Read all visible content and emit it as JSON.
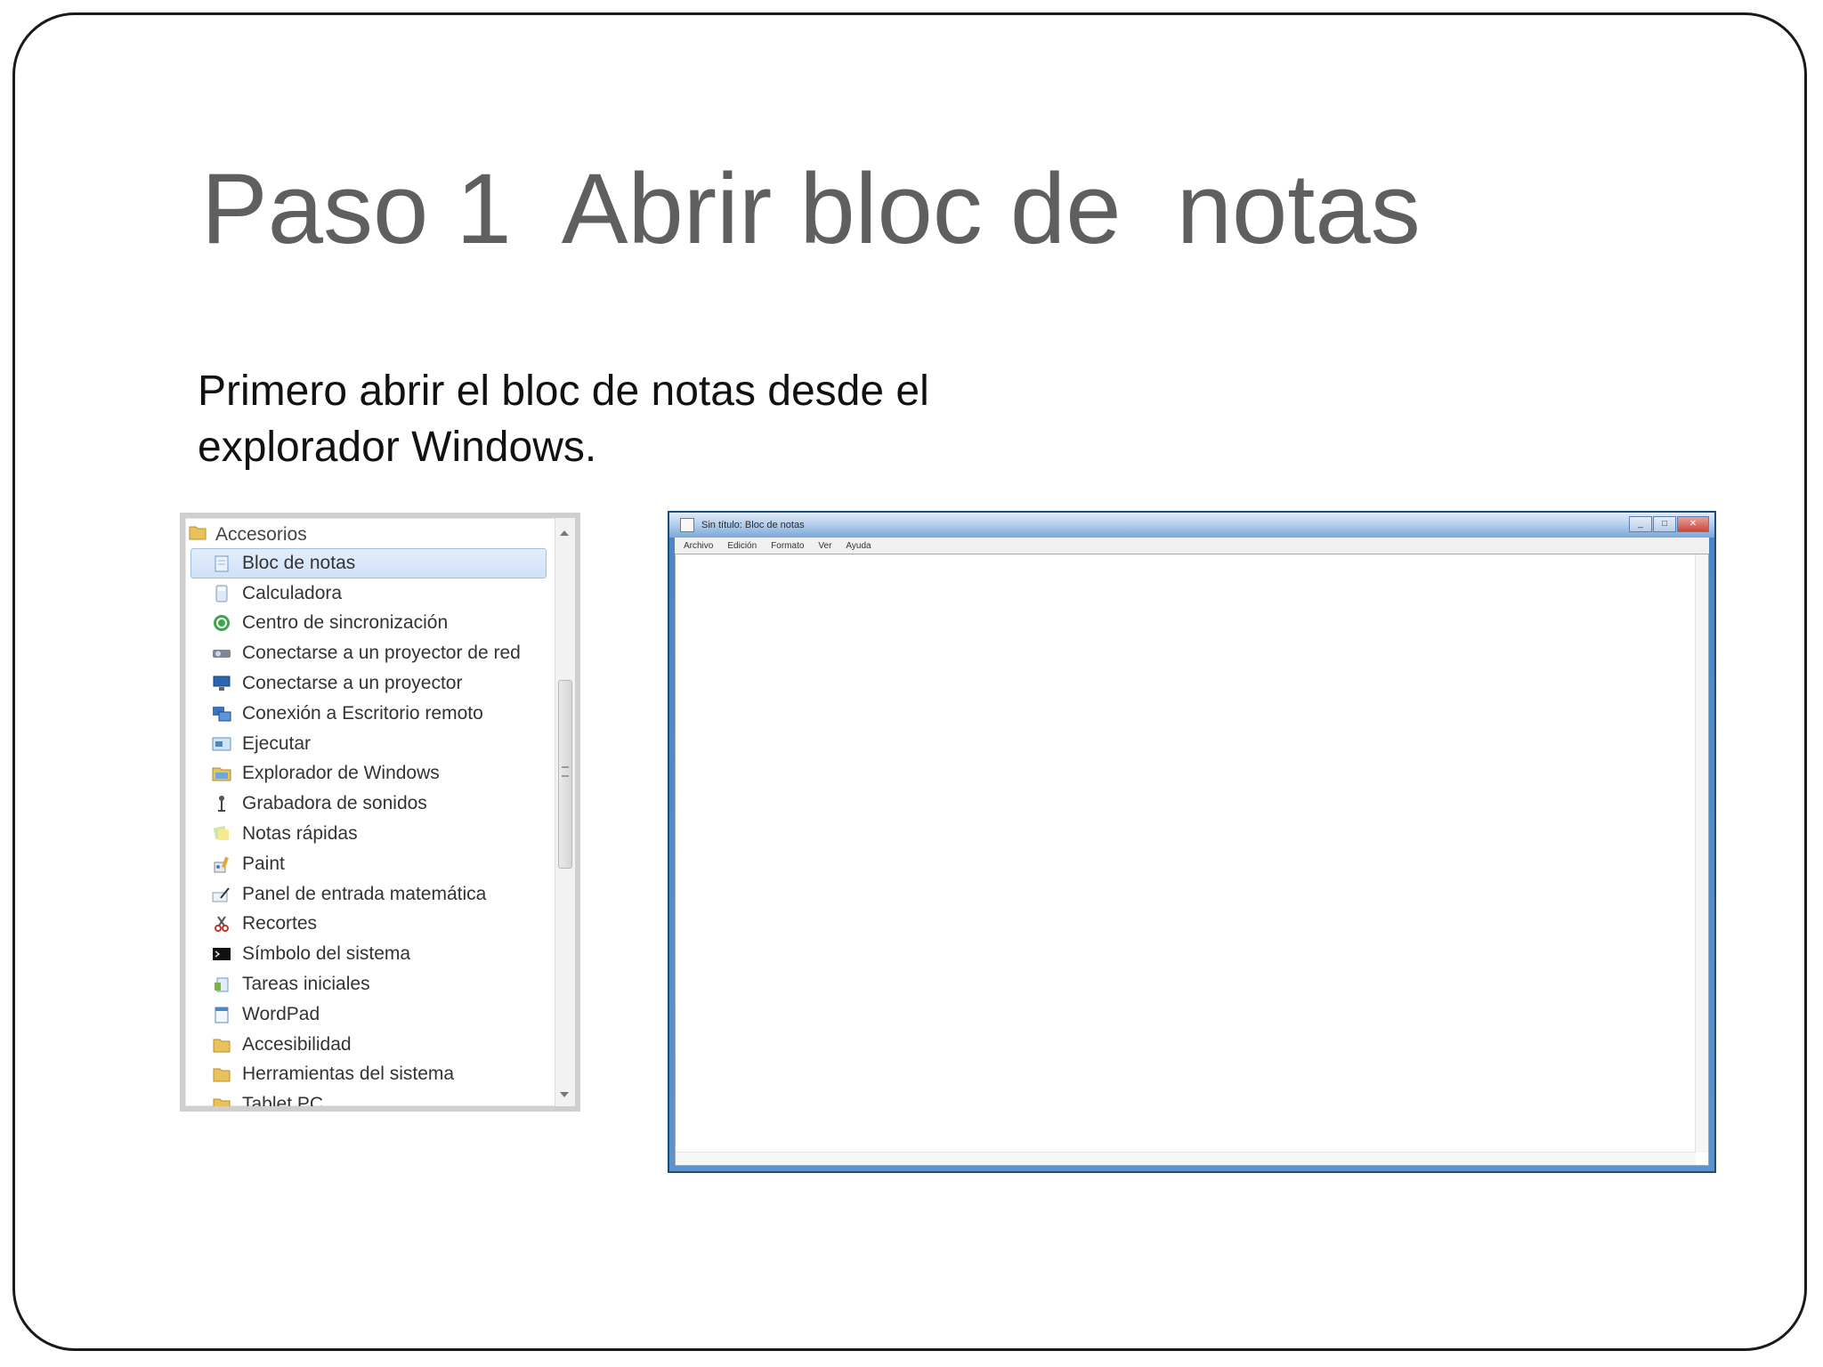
{
  "slide": {
    "title": "Paso 1  Abrir bloc de  notas",
    "body_line_1": "Primero abrir el bloc de notas desde el",
    "body_line_2": "explorador Windows."
  },
  "accessories_menu": {
    "header": "Accesorios",
    "items": [
      {
        "label": "Bloc de notas",
        "icon": "notepad-icon",
        "selected": true
      },
      {
        "label": "Calculadora",
        "icon": "calculator-icon"
      },
      {
        "label": "Centro de sincronización",
        "icon": "sync-center-icon"
      },
      {
        "label": "Conectarse a un proyector de red",
        "icon": "network-projector-icon"
      },
      {
        "label": "Conectarse a un proyector",
        "icon": "projector-icon"
      },
      {
        "label": "Conexión a Escritorio remoto",
        "icon": "remote-desktop-icon"
      },
      {
        "label": "Ejecutar",
        "icon": "run-icon"
      },
      {
        "label": "Explorador de Windows",
        "icon": "explorer-icon"
      },
      {
        "label": "Grabadora de sonidos",
        "icon": "microphone-icon"
      },
      {
        "label": "Notas rápidas",
        "icon": "sticky-notes-icon"
      },
      {
        "label": "Paint",
        "icon": "paint-icon"
      },
      {
        "label": "Panel de entrada matemática",
        "icon": "math-input-icon"
      },
      {
        "label": "Recortes",
        "icon": "snipping-tool-icon"
      },
      {
        "label": "Símbolo del sistema",
        "icon": "command-prompt-icon"
      },
      {
        "label": "Tareas iniciales",
        "icon": "getting-started-icon"
      },
      {
        "label": "WordPad",
        "icon": "wordpad-icon"
      },
      {
        "label": "Accesibilidad",
        "icon": "folder-icon"
      },
      {
        "label": "Herramientas del sistema",
        "icon": "folder-icon"
      },
      {
        "label": "Tablet PC",
        "icon": "folder-icon"
      }
    ]
  },
  "notepad": {
    "title": "Sin título: Bloc de notas",
    "menu": [
      "Archivo",
      "Edición",
      "Formato",
      "Ver",
      "Ayuda"
    ]
  },
  "colors": {
    "title_text": "#5f5f5f",
    "selection": "#cfe2f8",
    "window_frame": "#4c86c4"
  }
}
